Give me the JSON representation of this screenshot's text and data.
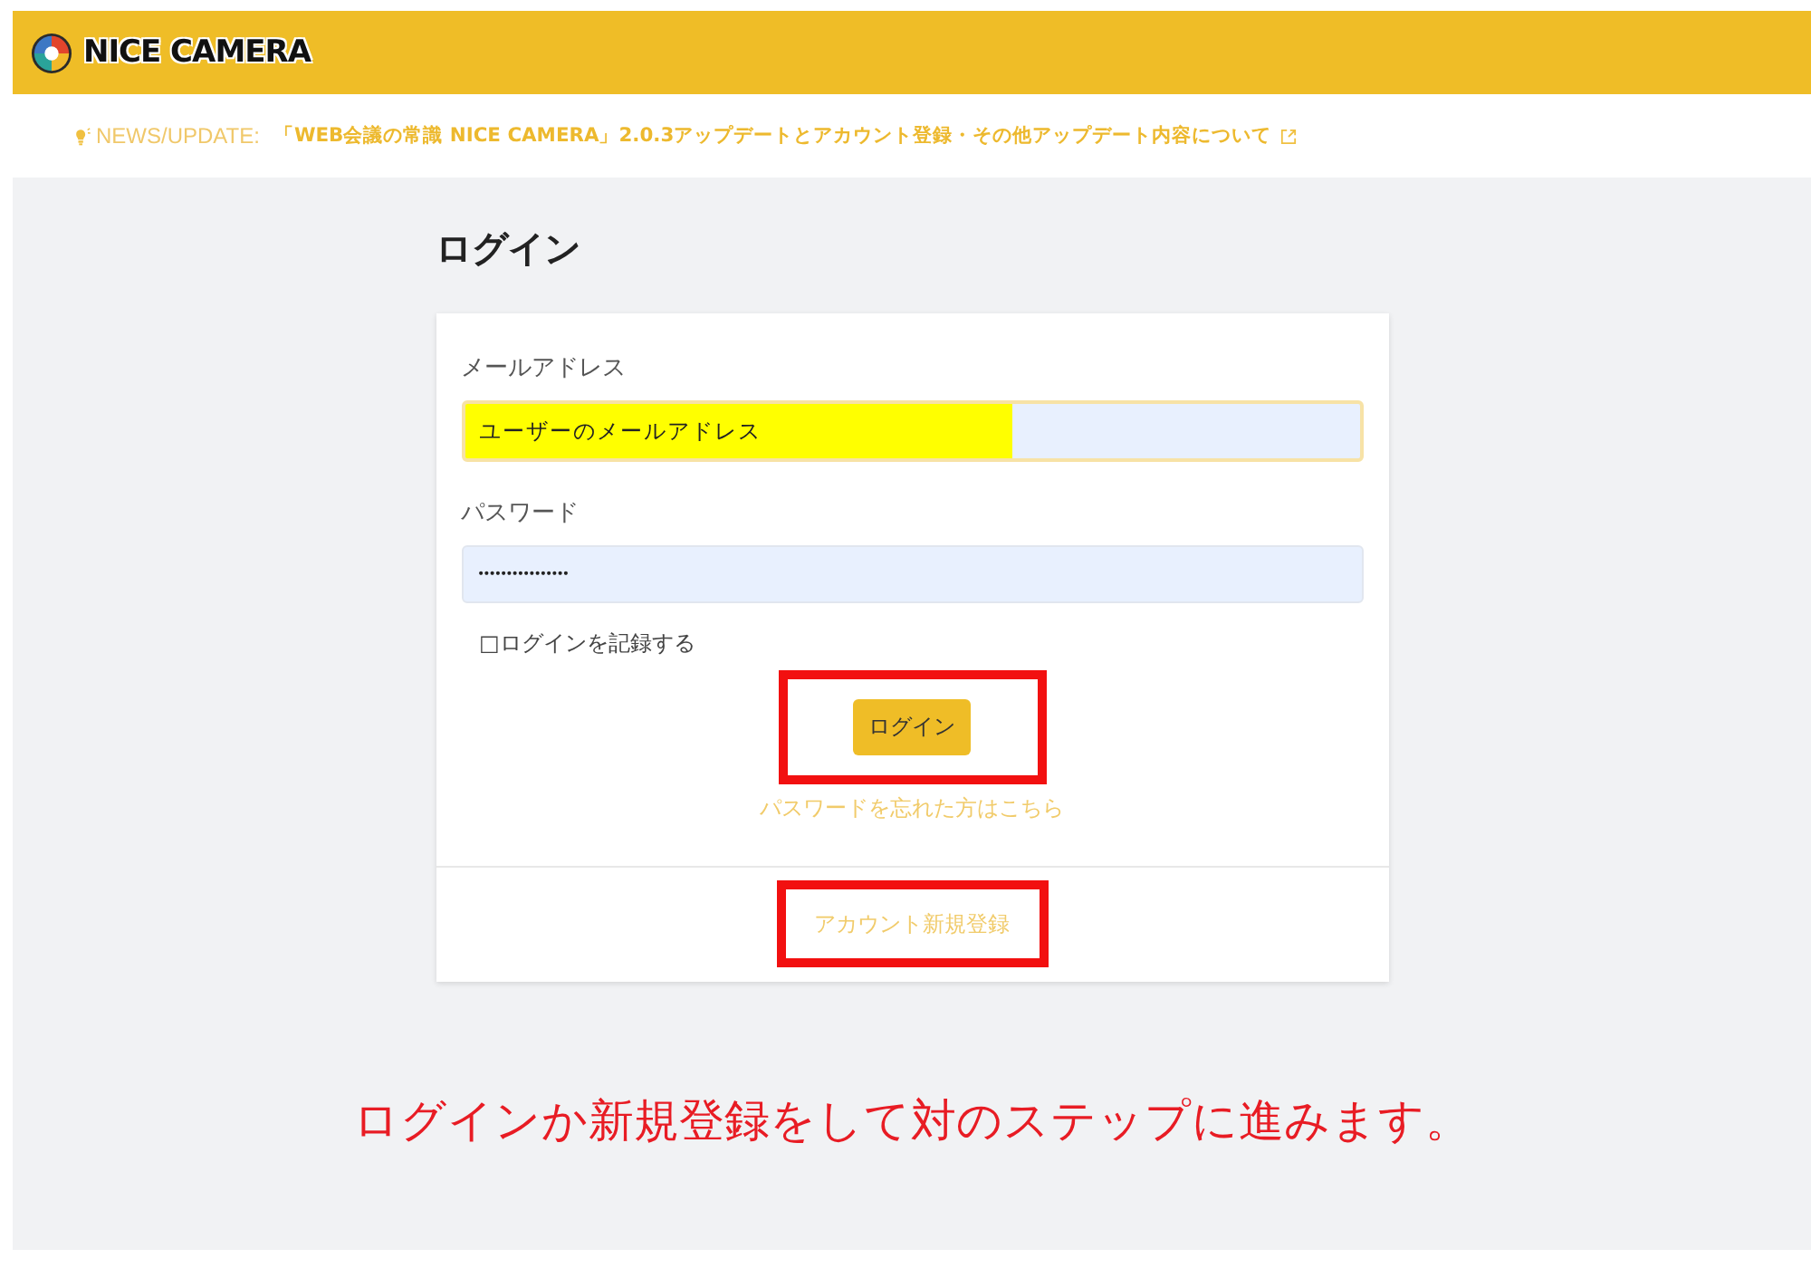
{
  "header": {
    "logo_text": "NICE CAMERA"
  },
  "news": {
    "label": "NEWS/UPDATE:",
    "link": "「WEB会議の常識 NICE CAMERA」2.0.3アップデートとアカウント登録・その他アップデート内容について"
  },
  "login": {
    "title": "ログイン",
    "fields": [
      {
        "label": "メールアドレス",
        "value": "ユーザーのメールアドレス",
        "kind": "text",
        "focused": true,
        "highlighted": true
      },
      {
        "label": "パスワード",
        "value": "••••••••••••••••",
        "kind": "password",
        "focused": false,
        "highlighted": false
      }
    ],
    "remember": "□ログインを記録する",
    "submit": {
      "label": "ログイン",
      "annotated": true
    },
    "forgot_link": "パスワードを忘れた方はこちら",
    "signup_link": {
      "label": "アカウント新規登録",
      "annotated": true
    }
  },
  "caption": "ログインか新規登録をして対のステップに進みます。"
}
